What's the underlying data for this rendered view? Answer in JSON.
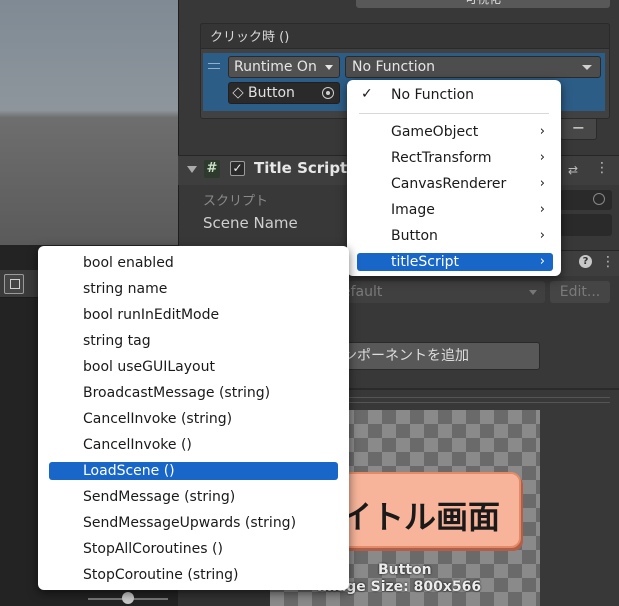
{
  "top": {
    "button_label": "可視化"
  },
  "event": {
    "title": "クリック時 ()",
    "runtime_dropdown": "Runtime On",
    "function_dropdown": "No Function",
    "object_field": "Button",
    "remove_label": "−"
  },
  "component": {
    "icon": "#",
    "checked": "✓",
    "title": "Title Script",
    "script_label": "スクリプト",
    "scene_name_label": "Scene Name"
  },
  "renderer": {
    "material_value": "efault",
    "edit_label": "Edit...",
    "help_icon": "?"
  },
  "add_component": {
    "label": "ンポーネントを追加"
  },
  "preview": {
    "button_text": "イトル画面",
    "name": "Button",
    "size": "Image Size: 800x566"
  },
  "component_menu": {
    "current": "No Function",
    "items": [
      {
        "label": "GameObject"
      },
      {
        "label": "RectTransform"
      },
      {
        "label": "CanvasRenderer"
      },
      {
        "label": "Image"
      },
      {
        "label": "Button"
      },
      {
        "label": "titleScript"
      }
    ]
  },
  "method_menu": {
    "items": [
      "bool enabled",
      "string name",
      "bool runInEditMode",
      "string tag",
      "bool useGUILayout",
      "BroadcastMessage (string)",
      "CancelInvoke (string)",
      "CancelInvoke ()",
      "LoadScene ()",
      "SendMessage (string)",
      "SendMessageUpwards (string)",
      "StopAllCoroutines ()",
      "StopCoroutine (string)"
    ],
    "selected_index": 8
  },
  "colors": {
    "selection": "#1866c7",
    "button_fill": "#f7b49a"
  },
  "icons": {
    "checkmark": "✓",
    "chevron": "›",
    "more": "⋮",
    "settings": "⇄"
  }
}
